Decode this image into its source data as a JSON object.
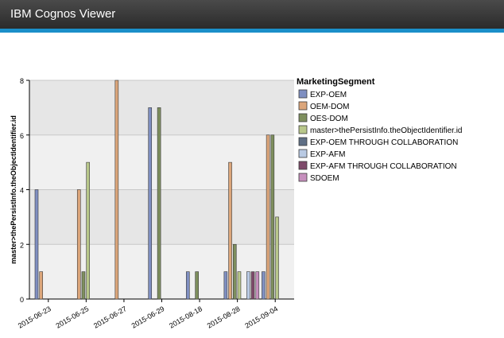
{
  "window": {
    "title": "IBM Cognos Viewer"
  },
  "colors": {
    "titlebar": "#333333",
    "accent": "#1b8fc9",
    "plot_band_light": "#f0f0f0",
    "plot_band_dark": "#e6e6e6"
  },
  "chart_data": {
    "type": "bar",
    "title": "",
    "xlabel": "",
    "ylabel": "master>thePersistInfo.theObjectIdentifier.id",
    "ylim": [
      0,
      8
    ],
    "yticks": [
      0,
      2,
      4,
      6,
      8
    ],
    "grid": true,
    "legend": {
      "title": "MarketingSegment",
      "placement": "right"
    },
    "categories": [
      "2015-06-23",
      "2015-06-25",
      "2015-06-27",
      "2015-06-29",
      "2015-08-18",
      "2015-08-28",
      "2015-09-04"
    ],
    "series": [
      {
        "name": "EXP-OEM",
        "color": "#7f8fc1",
        "values": [
          4,
          null,
          null,
          7,
          1,
          1,
          1
        ]
      },
      {
        "name": "OEM-DOM",
        "color": "#dca67b",
        "values": [
          1,
          4,
          8,
          null,
          null,
          5,
          6
        ]
      },
      {
        "name": "OES-DOM",
        "color": "#7e8f5e",
        "values": [
          null,
          1,
          null,
          7,
          1,
          2,
          6
        ]
      },
      {
        "name": "master>thePersistInfo.theObjectIdentifier.id",
        "color": "#b8c78a",
        "values": [
          null,
          5,
          null,
          null,
          null,
          1,
          3
        ]
      },
      {
        "name": "EXP-OEM THROUGH COLLABORATION",
        "color": "#5f6f85",
        "values": [
          null,
          null,
          null,
          null,
          null,
          null,
          null
        ]
      },
      {
        "name": "EXP-AFM",
        "color": "#b9cae3",
        "values": [
          null,
          null,
          null,
          null,
          null,
          1,
          null
        ]
      },
      {
        "name": "EXP-AFM THROUGH COLLABORATION",
        "color": "#7e4a6a",
        "values": [
          null,
          null,
          null,
          null,
          null,
          1,
          null
        ]
      },
      {
        "name": "SDOEM",
        "color": "#c68fbd",
        "values": [
          null,
          null,
          null,
          null,
          null,
          1,
          null
        ]
      }
    ]
  }
}
